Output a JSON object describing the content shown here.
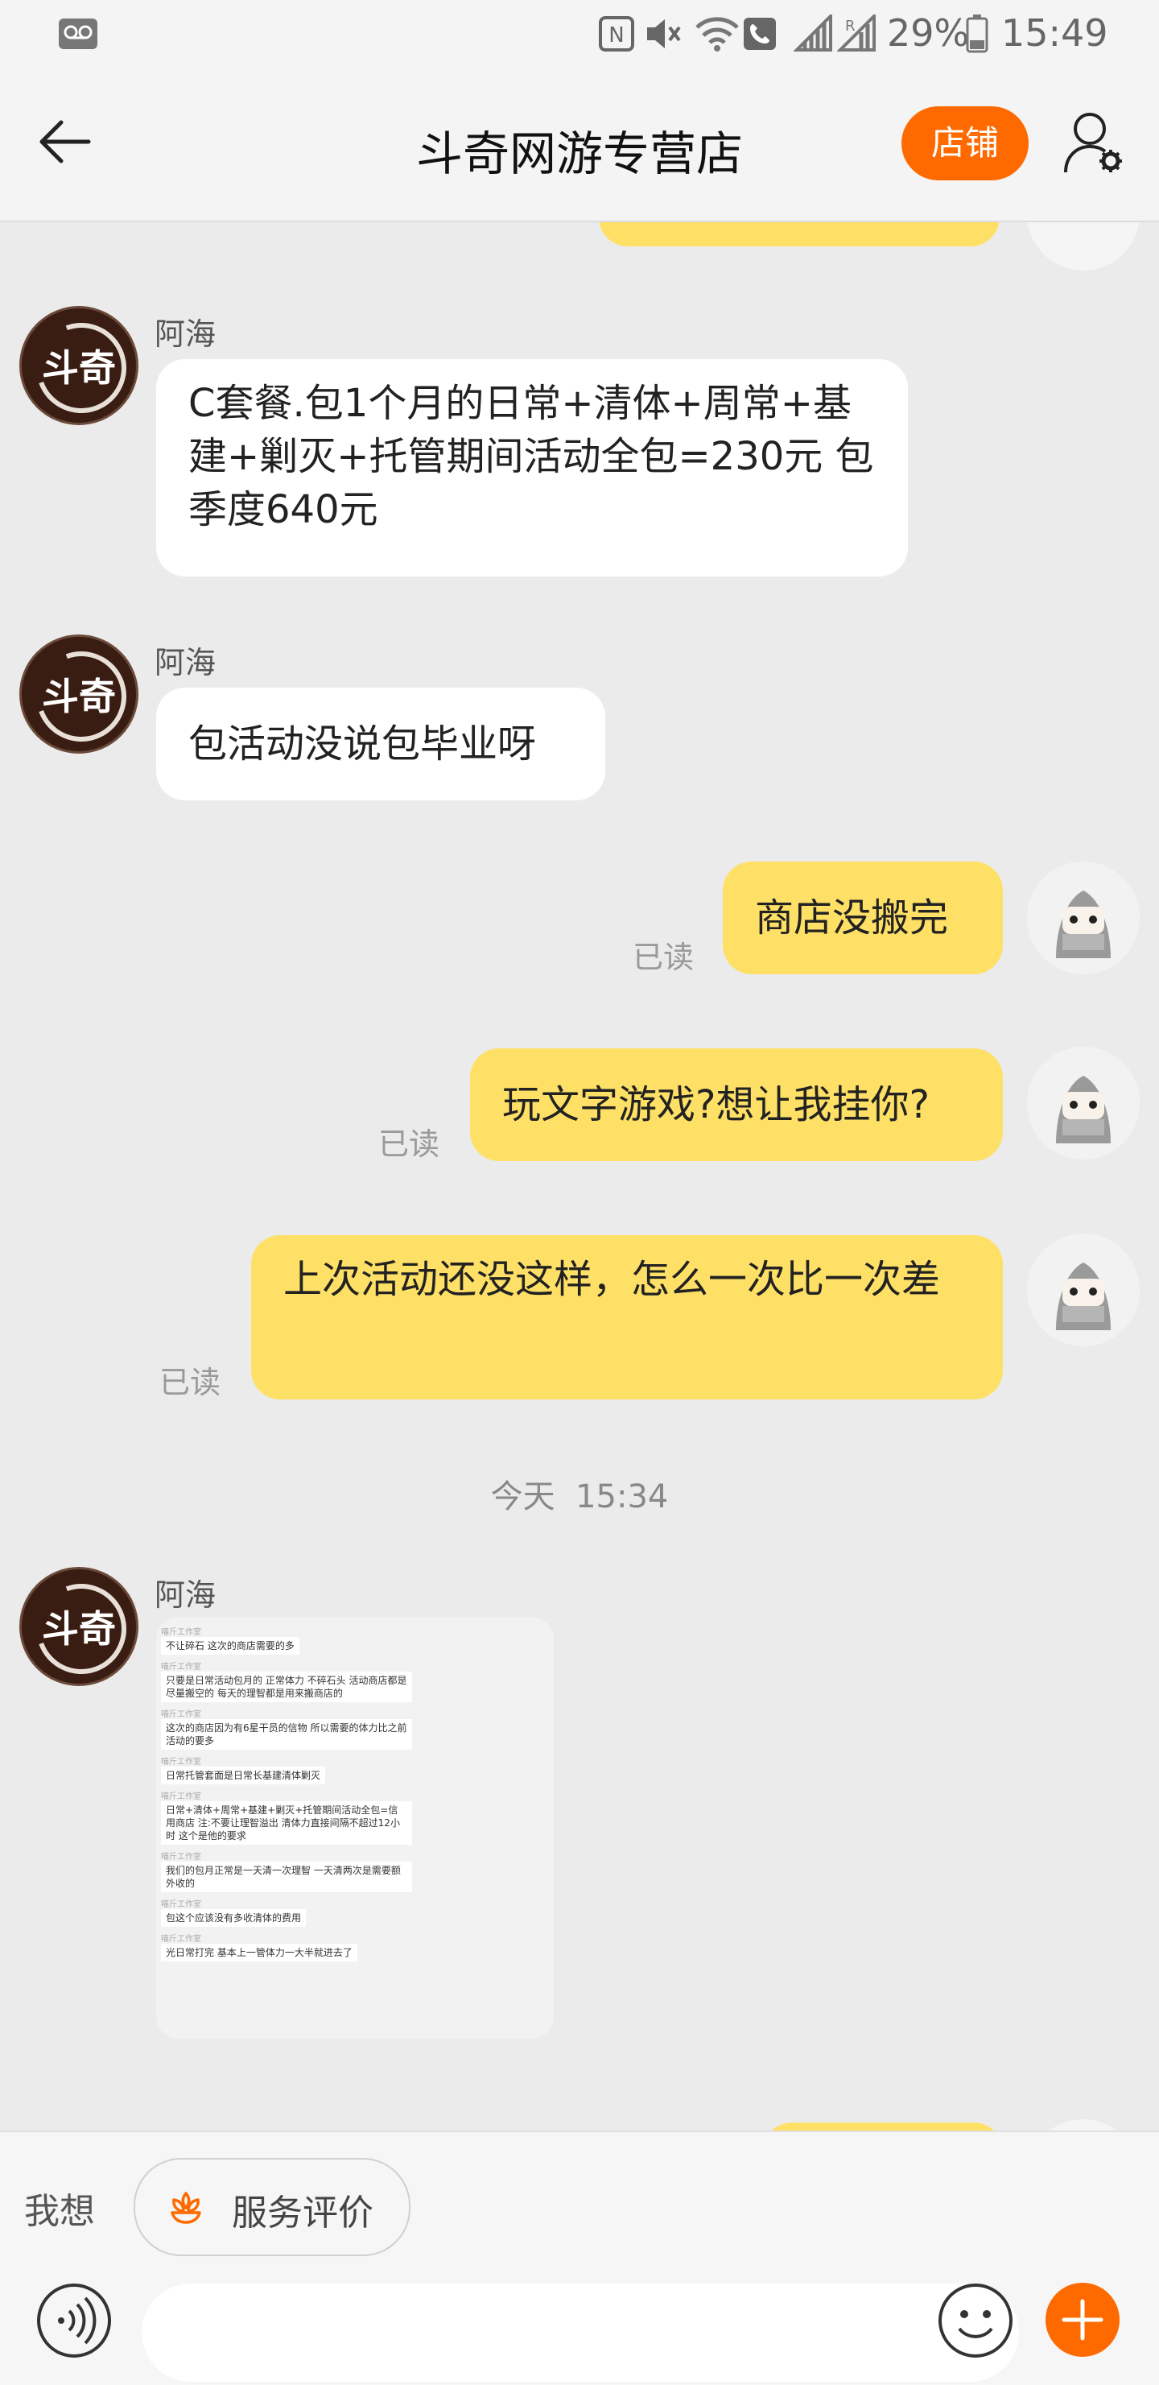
{
  "status_bar": {
    "battery": "29%",
    "time": "15:49",
    "icons": [
      "voicemail-icon",
      "nfc-icon",
      "mute-icon",
      "wifi-icon",
      "call-icon",
      "signal-icon",
      "signal-r-icon",
      "battery-icon"
    ]
  },
  "header": {
    "title": "斗奇网游专营店",
    "shop_button": "店铺",
    "back_icon": "back-arrow-icon",
    "profile_icon": "user-settings-icon"
  },
  "colors": {
    "accent": "#ff6a00",
    "bubble_self": "#ffe066",
    "bubble_other": "#ffffff",
    "background": "#ebebeb"
  },
  "avatar_text": "斗奇",
  "messages": [
    {
      "sender": "阿海",
      "text": "C套餐.包1个月的日常+清体+周常+基建+剿灭+托管期间活动全包=230元 包季度640元"
    },
    {
      "sender": "阿海",
      "text": "包活动没说包毕业呀"
    },
    {
      "sender": "self",
      "text": "商店没搬完",
      "status": "已读"
    },
    {
      "sender": "self",
      "text": "玩文字游戏?想让我挂你?",
      "status": "已读"
    },
    {
      "sender": "self",
      "text": "上次活动还没这样，怎么一次比一次差",
      "status": "已读"
    },
    {
      "sender": "阿海",
      "type": "image"
    }
  ],
  "date_divider": "今天  15:34",
  "screenshot_lines": [
    "不让碎石 这次的商店需要的多",
    "只要是日常活动包月的  正常体力 不碎石头  活动商店都是尽量搬空的   每天的理智都是用来搬商店的",
    "这次的商店因为有6星干员的信物  所以需要的体力比之前活动的要多",
    "日常托管套面是日常长基建清体剿灭",
    "日常+清体+周常+基建+剿灭+托管期间活动全包=信用商店 注:不要让理智溢出  清体力直接间隔不超过12小时 这个是他的要求",
    "我们的包月正常是一天清一次理智  一天清两次是需要额外收的",
    "包这个应该没有多收清体的费用",
    "光日常打完  基本上一管体力一大半就进去了"
  ],
  "screenshot_sender": "喵斤工作室",
  "bottom": {
    "prompt": "我想",
    "service_button": "服务评价",
    "input_placeholder": "",
    "icons": [
      "voice-icon",
      "emoji-icon",
      "plus-icon"
    ]
  }
}
